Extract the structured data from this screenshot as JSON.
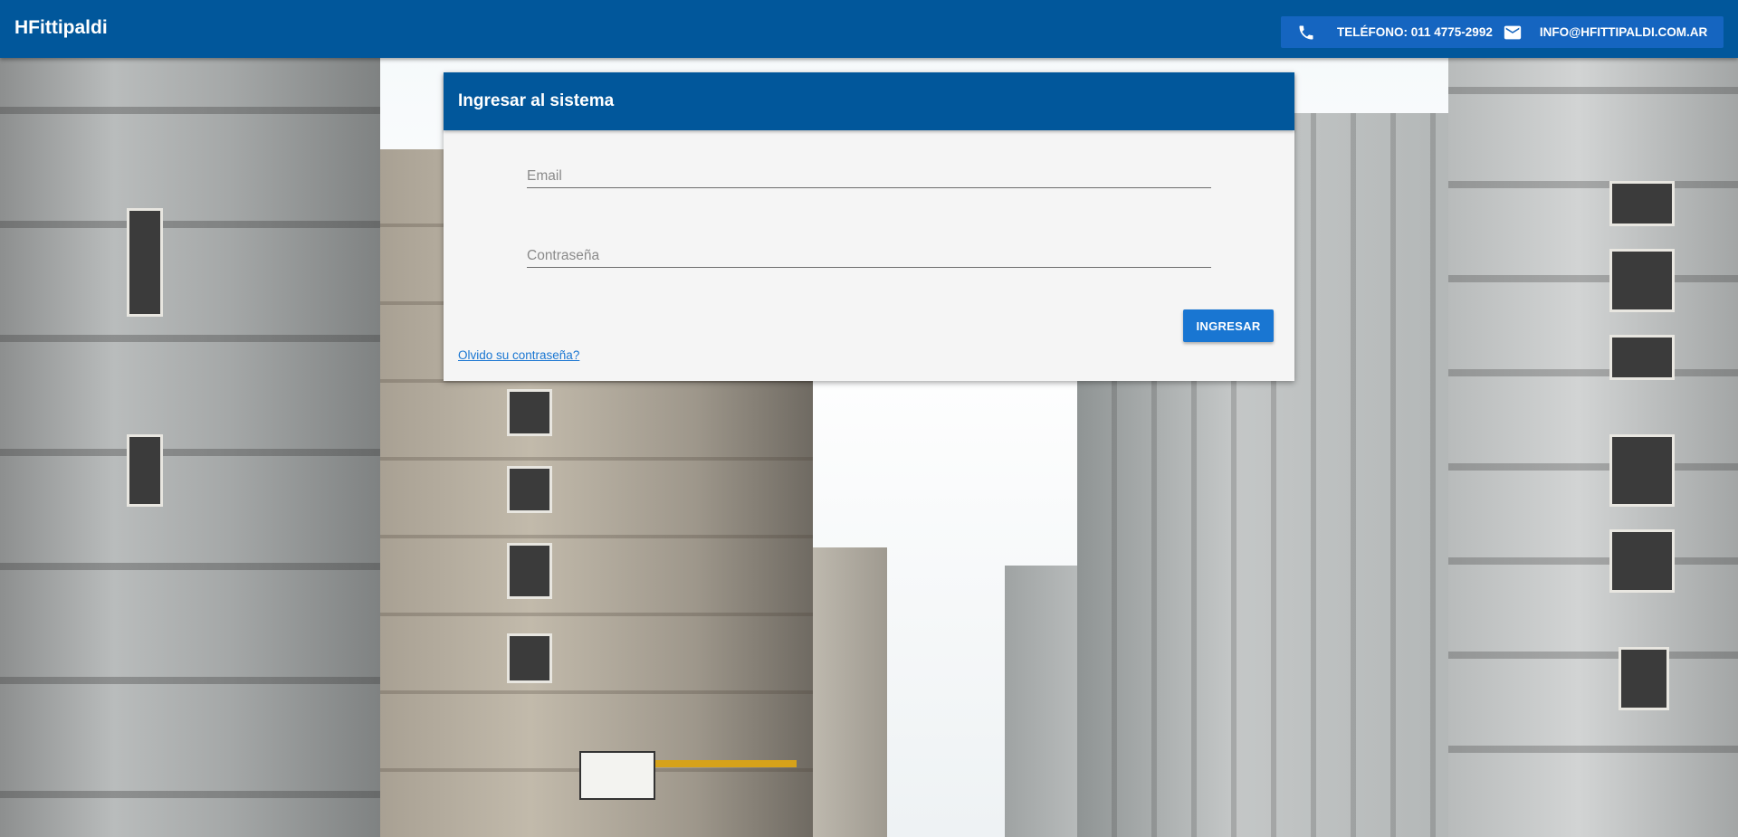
{
  "app": {
    "brand": "HFittipaldi"
  },
  "contact": {
    "phone_icon": "phone-icon",
    "phone_text": "TELÉFONO: 011 4775-2992",
    "mail_icon": "mail-icon",
    "email_text": "INFO@HFITTIPALDI.COM.AR"
  },
  "login": {
    "title": "Ingresar al sistema",
    "email_placeholder": "Email",
    "email_value": "",
    "password_placeholder": "Contraseña",
    "password_value": "",
    "submit_label": "INGRESAR",
    "forgot_label": "Olvido su contraseña?"
  },
  "colors": {
    "appbar": "#01579b",
    "contact_box": "#1565c0",
    "button": "#1976d2",
    "card_bg": "#f5f5f5"
  }
}
